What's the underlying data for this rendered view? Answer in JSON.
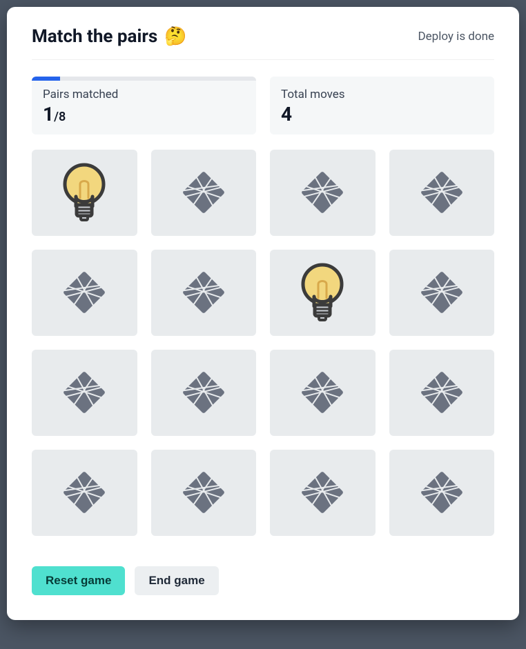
{
  "header": {
    "title": "Match the pairs",
    "emoji": "🤔",
    "status": "Deploy is done"
  },
  "stats": {
    "pairs_label": "Pairs matched",
    "pairs_matched": "1",
    "pairs_total": "8",
    "progress_percent": 12.5,
    "moves_label": "Total moves",
    "moves_value": "4"
  },
  "cards": [
    {
      "state": "revealed",
      "face": "lightbulb"
    },
    {
      "state": "hidden",
      "face": "back"
    },
    {
      "state": "hidden",
      "face": "back"
    },
    {
      "state": "hidden",
      "face": "back"
    },
    {
      "state": "hidden",
      "face": "back"
    },
    {
      "state": "hidden",
      "face": "back"
    },
    {
      "state": "revealed",
      "face": "lightbulb"
    },
    {
      "state": "hidden",
      "face": "back"
    },
    {
      "state": "hidden",
      "face": "back"
    },
    {
      "state": "hidden",
      "face": "back"
    },
    {
      "state": "hidden",
      "face": "back"
    },
    {
      "state": "hidden",
      "face": "back"
    },
    {
      "state": "hidden",
      "face": "back"
    },
    {
      "state": "hidden",
      "face": "back"
    },
    {
      "state": "hidden",
      "face": "back"
    },
    {
      "state": "hidden",
      "face": "back"
    }
  ],
  "footer": {
    "reset_label": "Reset game",
    "end_label": "End game"
  }
}
